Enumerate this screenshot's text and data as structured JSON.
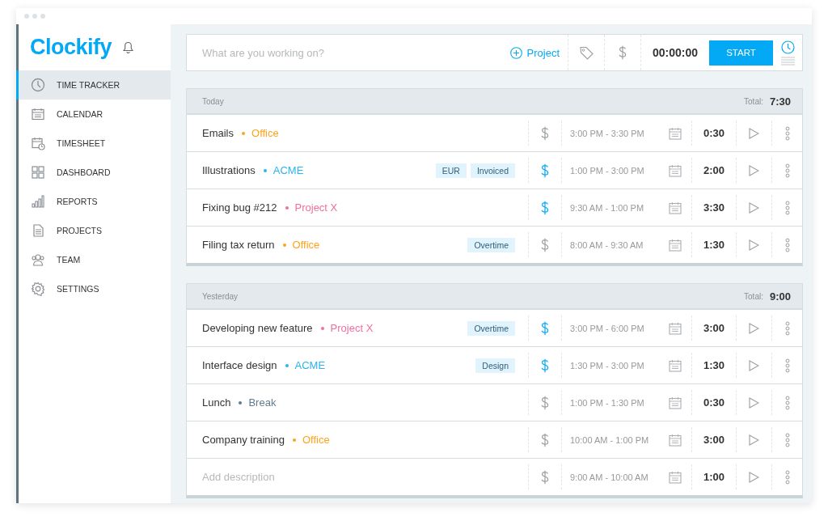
{
  "sidebar": {
    "logo": "Clockify",
    "items": [
      {
        "label": "TIME TRACKER",
        "selected": true
      },
      {
        "label": "CALENDAR",
        "selected": false
      },
      {
        "label": "TIMESHEET",
        "selected": false
      },
      {
        "label": "DASHBOARD",
        "selected": false
      },
      {
        "label": "REPORTS",
        "selected": false
      },
      {
        "label": "PROJECTS",
        "selected": false
      },
      {
        "label": "TEAM",
        "selected": false
      },
      {
        "label": "SETTINGS",
        "selected": false
      }
    ]
  },
  "tracker": {
    "placeholder": "What are you working on?",
    "project_button": "Project",
    "timer": "00:00:00",
    "start_button": "START",
    "modes": [
      {
        "kind": "timer",
        "selected": true
      },
      {
        "kind": "manual",
        "selected": false
      }
    ]
  },
  "days": [
    {
      "label": "Today",
      "total_label": "Total:",
      "total": "7:30",
      "entries": [
        {
          "description": "Emails",
          "project": "Office",
          "color": "#ffa21a",
          "billable": false,
          "time_range": "3:00 PM - 3:30 PM",
          "duration": "0:30"
        },
        {
          "description": "Illustrations",
          "project": "ACME",
          "color": "#2ab4f0",
          "tags": [
            "EUR",
            "Invoiced"
          ],
          "billable": true,
          "time_range": "1:00 PM - 3:00 PM",
          "duration": "2:00"
        },
        {
          "description": "Fixing bug #212",
          "project": "Project X",
          "color": "#f06ea0",
          "billable": true,
          "time_range": "9:30 AM - 1:00 PM",
          "duration": "3:30"
        },
        {
          "description": "Filing tax return",
          "project": "Office",
          "color": "#ffa21a",
          "tags": [
            "Overtime"
          ],
          "billable": false,
          "time_range": "8:00 AM - 9:30 AM",
          "duration": "1:30"
        }
      ]
    },
    {
      "label": "Yesterday",
      "total_label": "Total:",
      "total": "9:00",
      "entries": [
        {
          "description": "Developing new feature",
          "project": "Project X",
          "color": "#f06ea0",
          "tags": [
            "Overtime"
          ],
          "billable": true,
          "time_range": "3:00 PM - 6:00 PM",
          "duration": "3:00"
        },
        {
          "description": "Interface design",
          "project": "ACME",
          "color": "#2ab4f0",
          "tags": [
            "Design"
          ],
          "billable": true,
          "time_range": "1:30 PM - 3:00 PM",
          "duration": "1:30"
        },
        {
          "description": "Lunch",
          "project": "Break",
          "color": "#5f7d8e",
          "billable": false,
          "time_range": "1:00 PM - 1:30 PM",
          "duration": "0:30"
        },
        {
          "description": "Company training",
          "project": "Office",
          "color": "#ffa21a",
          "billable": false,
          "time_range": "10:00 AM - 1:00 PM",
          "duration": "3:00"
        },
        {
          "placeholder": "Add description",
          "billable": false,
          "time_range": "9:00 AM - 10:00 AM",
          "duration": "1:00"
        }
      ]
    }
  ]
}
